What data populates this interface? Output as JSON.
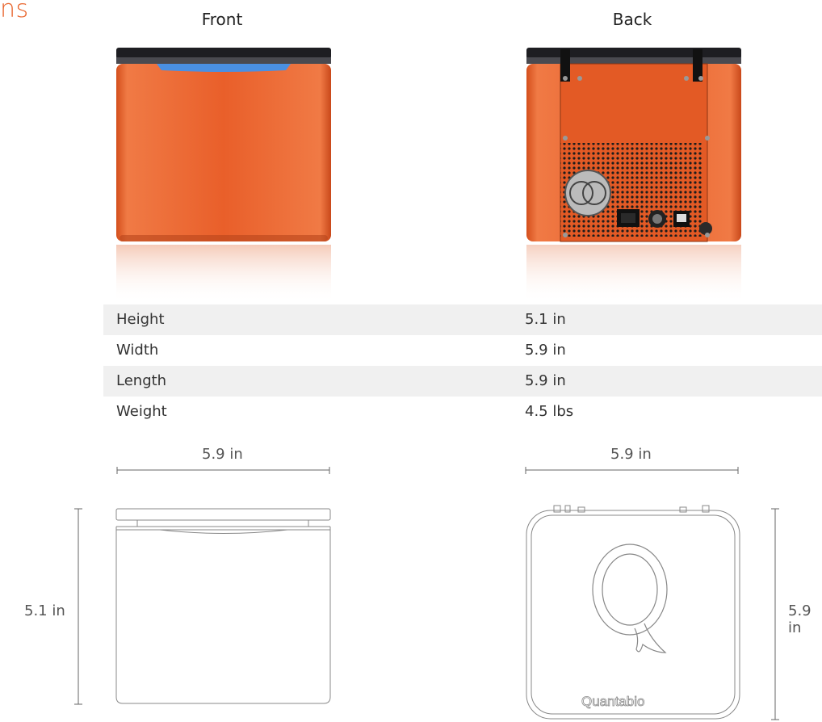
{
  "heading_fragment": "ns",
  "views": {
    "front_label": "Front",
    "back_label": "Back"
  },
  "specs": [
    {
      "name": "Height",
      "value": "5.1 in"
    },
    {
      "name": "Width",
      "value": "5.9 in"
    },
    {
      "name": "Length",
      "value": "5.9 in"
    },
    {
      "name": "Weight",
      "value": "4.5 lbs"
    }
  ],
  "dimensions": {
    "front_width": "5.9 in",
    "front_height": "5.1 in",
    "back_width": "5.9 in",
    "back_length": "5.9 in"
  },
  "brand": {
    "logo_text": "Quantabio"
  },
  "colors": {
    "device_orange": "#e8602c",
    "lid_black": "#1e1e22",
    "accent_blue": "#4a90e2",
    "heading_orange": "#e8642c"
  }
}
